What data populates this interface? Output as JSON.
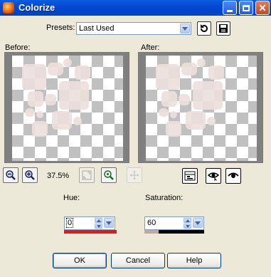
{
  "window": {
    "title": "Colorize"
  },
  "presets": {
    "label": "Presets:",
    "value": "Last Used"
  },
  "preview": {
    "before_label": "Before:",
    "after_label": "After:"
  },
  "zoom": {
    "level": "37.5%"
  },
  "hue": {
    "label": "Hue:",
    "value": "0"
  },
  "saturation": {
    "label": "Saturation:",
    "value": "60"
  },
  "buttons": {
    "ok": "OK",
    "cancel": "Cancel",
    "help": "Help"
  },
  "colors": {
    "titlebar": "#0348d2",
    "dialog_bg": "#ece9d8",
    "hue_swatch": "#e41919",
    "object_tint": "#ecdfdd"
  },
  "icons": [
    "app-icon",
    "minimize-icon",
    "maximize-icon",
    "close-icon",
    "reset-icon",
    "save-icon",
    "zoom-out-icon",
    "zoom-in-icon",
    "fit-window-icon",
    "zoom-target-icon",
    "pan-icon",
    "proof-icon",
    "auto-proof-icon",
    "eye-icon"
  ]
}
